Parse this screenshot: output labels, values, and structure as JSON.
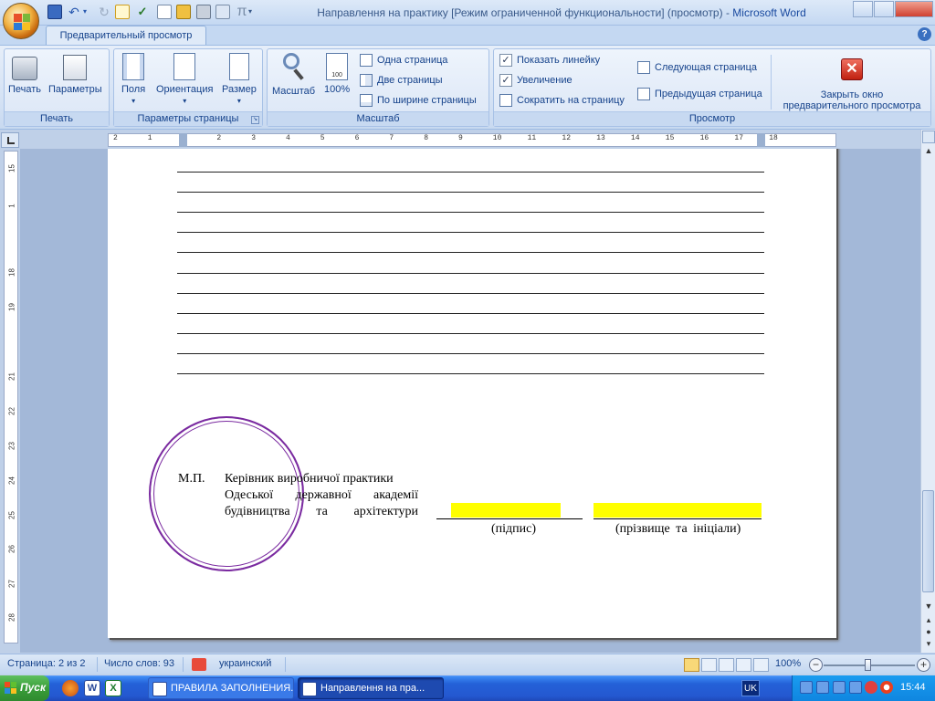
{
  "window": {
    "title_main": "Направлення на практику [Режим ограниченной функциональности] (просмотр) - ",
    "title_app": "Microsoft Word"
  },
  "ribbon": {
    "tab": "Предварительный просмотр",
    "groups": {
      "print": {
        "label": "Печать",
        "print_btn": "Печать",
        "params_btn": "Параметры"
      },
      "page_setup": {
        "label": "Параметры страницы",
        "margins_btn": "Поля",
        "orientation_btn": "Ориентация",
        "size_btn": "Размер"
      },
      "zoom": {
        "label": "Масштаб",
        "zoom_btn": "Масштаб",
        "zoom100_btn": "100%",
        "zoom100_icon_text": "100",
        "one_page": "Одна страница",
        "two_pages": "Две страницы",
        "page_width": "По ширине страницы"
      },
      "preview": {
        "label": "Просмотр",
        "show_ruler": "Показать линейку",
        "magnifier": "Увеличение",
        "shrink": "Сократить на страницу",
        "next_page": "Следующая страница",
        "prev_page": "Предыдущая страница",
        "close_line1": "Закрыть окно",
        "close_line2": "предварительного просмотра"
      }
    }
  },
  "rulers": {
    "horizontal": [
      "2",
      "1",
      "1",
      "2",
      "3",
      "4",
      "5",
      "6",
      "7",
      "8",
      "9",
      "10",
      "11",
      "12",
      "13",
      "14",
      "15",
      "16",
      "17",
      "18"
    ],
    "vertical": [
      "15",
      "1",
      "18",
      "19",
      "21",
      "22",
      "23",
      "24",
      "25",
      "26",
      "27",
      "28"
    ]
  },
  "document": {
    "mp": "М.П.",
    "supervisor_line1": "Керівник виробничої практики",
    "supervisor_line2": "Одеської державної академії",
    "supervisor_line3": "будівництва та архітектури",
    "signature_caption": "(підпис)",
    "name_caption": "(прізвище та ініціали)"
  },
  "status": {
    "page": "Страница: 2 из 2",
    "words": "Число слов: 93",
    "language": "украинский",
    "zoom": "100%"
  },
  "taskbar": {
    "start": "Пуск",
    "tasks": [
      "ПРАВИЛА ЗАПОЛНЕНИЯ...",
      "Направлення на пра..."
    ],
    "lang": "UK",
    "clock": "15:44"
  }
}
